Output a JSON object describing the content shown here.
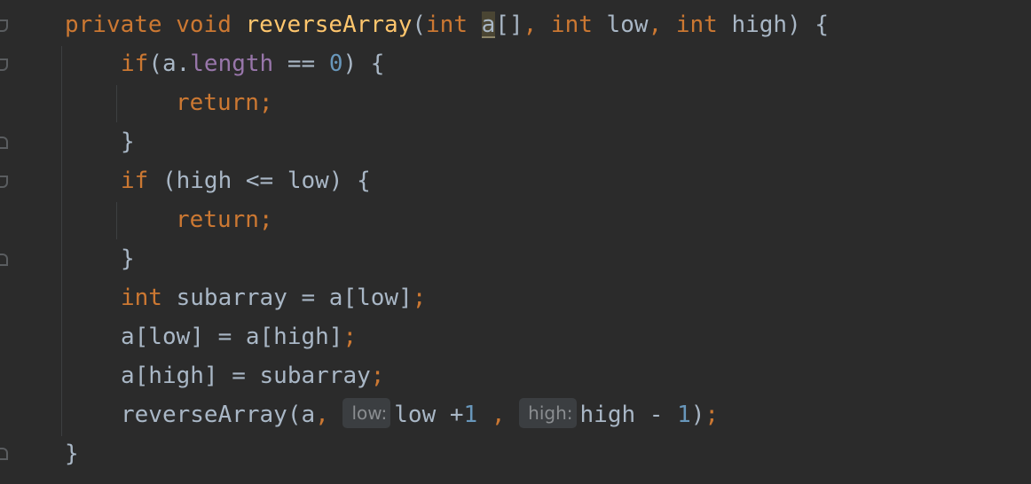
{
  "code": {
    "line1": {
      "private": "private",
      "void": "void",
      "name": "reverseArray",
      "open": "(",
      "int1": "int",
      "param_a": "a",
      "arr_suffix": "[]",
      "comma1": ",",
      "int2": "int",
      "low": "low",
      "comma2": ",",
      "int3": "int",
      "high_brace": "high) {"
    },
    "line2": {
      "if": "if",
      "lhs": "(a.",
      "length": "length",
      "op": " == ",
      "zero": "0",
      "end": ") {"
    },
    "line3": {
      "return": "return;"
    },
    "line4": {
      "brace": "}"
    },
    "line5": {
      "if": "if",
      "cond": "(high <= low) {"
    },
    "line6": {
      "return": "return;"
    },
    "line7": {
      "brace": "}"
    },
    "line8": {
      "int": "int",
      "text": "subarray = a[low]",
      "semi": ";"
    },
    "line9": {
      "text": "a[low] = a[high]",
      "semi": ";"
    },
    "line10": {
      "text": "a[high] = subarray",
      "semi": ";"
    },
    "line11": {
      "call": "reverseArray(a",
      "comma1": ",",
      "hint_low": "low:",
      "low_expr": "low +",
      "one1": "1",
      "comma2": ",",
      "hint_high": "high:",
      "high_expr": "high - ",
      "one2": "1",
      "close": ")",
      "semi": ";"
    },
    "line12": {
      "brace": "}"
    }
  }
}
